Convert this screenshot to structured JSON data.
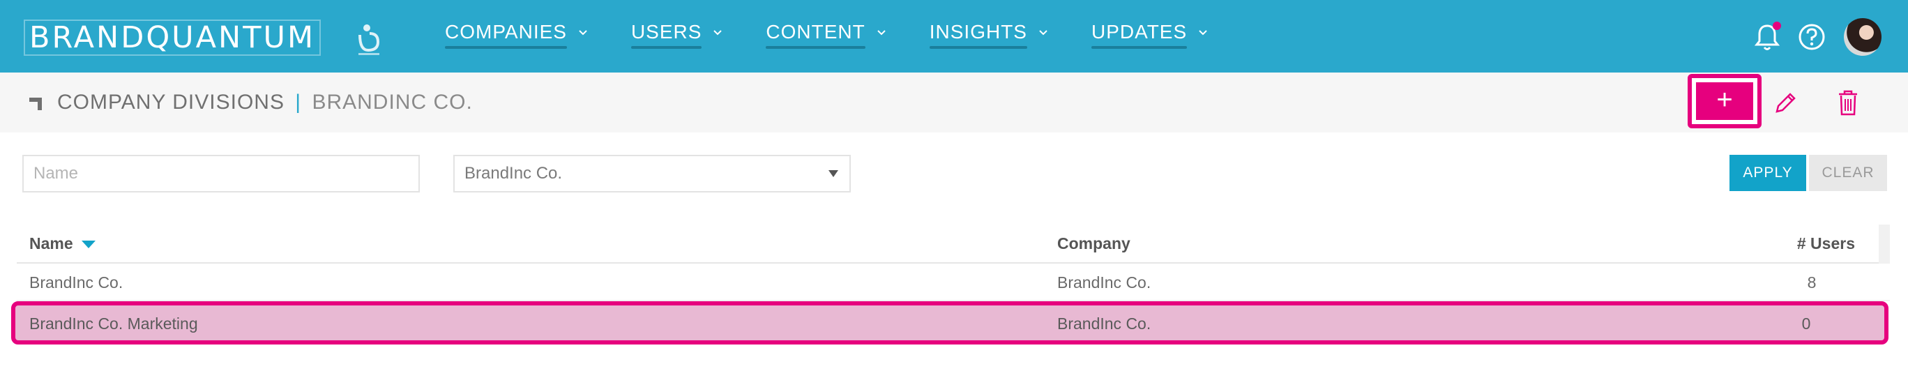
{
  "brand": {
    "logo_text": "BRANDQUANTUM"
  },
  "nav": {
    "items": [
      {
        "label": "COMPANIES"
      },
      {
        "label": "USERS"
      },
      {
        "label": "CONTENT"
      },
      {
        "label": "INSIGHTS"
      },
      {
        "label": "UPDATES"
      }
    ]
  },
  "header": {
    "title": "COMPANY DIVISIONS",
    "separator": "|",
    "subtitle": "BRANDINC CO.",
    "add_label": "+"
  },
  "filters": {
    "name_placeholder": "Name",
    "company_selected": "BrandInc Co.",
    "apply_label": "APPLY",
    "clear_label": "CLEAR"
  },
  "table": {
    "columns": {
      "name": "Name",
      "company": "Company",
      "users": "# Users"
    },
    "rows": [
      {
        "name": "BrandInc Co.",
        "company": "BrandInc Co.",
        "users": "8"
      },
      {
        "name": "BrandInc Co. Marketing",
        "company": "BrandInc Co.",
        "users": "0"
      }
    ]
  },
  "colors": {
    "topbar": "#2aa8cc",
    "accent": "#e6007e",
    "apply": "#12a3c9",
    "selected_row": "#e8b9d3"
  },
  "icons": [
    "chevron-down-icon",
    "bell-icon",
    "help-icon",
    "pencil-icon",
    "trash-icon",
    "sort-desc-icon",
    "corner-icon"
  ]
}
